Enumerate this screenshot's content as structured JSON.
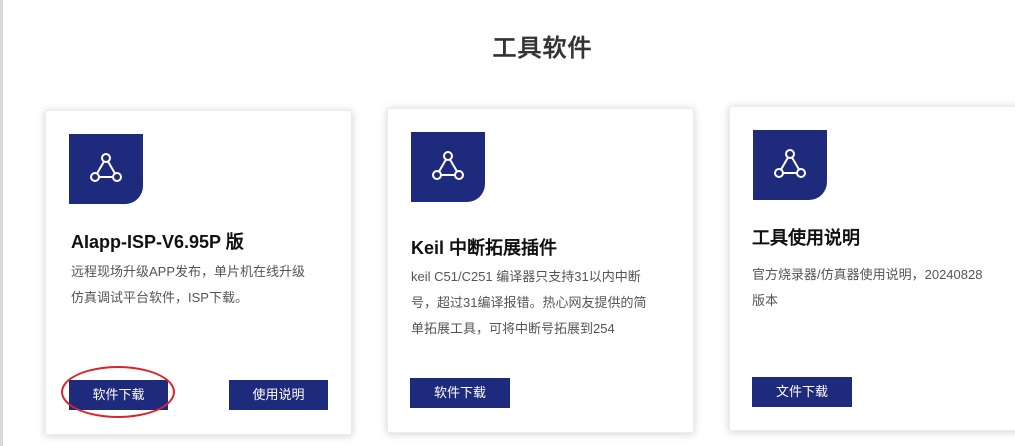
{
  "section": {
    "title": "工具软件"
  },
  "cards": [
    {
      "icon": "triangle-network-icon",
      "title": "AIapp-ISP-V6.95P 版",
      "desc_lines": [
        "远程现场升级APP发布，单片机在线升级",
        "仿真调试平台软件，ISP下载。"
      ],
      "buttons": [
        "软件下载",
        "使用说明"
      ]
    },
    {
      "icon": "triangle-network-icon",
      "title": "Keil 中断拓展插件",
      "desc_lines": [
        "keil C51/C251 编译器只支持31以内中断",
        "号，超过31编译报错。热心网友提供的简",
        "单拓展工具，可将中断号拓展到254"
      ],
      "buttons": [
        "软件下载"
      ]
    },
    {
      "icon": "triangle-network-icon",
      "title": "工具使用说明",
      "desc_lines": [
        "官方烧录器/仿真器使用说明，20240828",
        "版本"
      ],
      "buttons": [
        "文件下载"
      ]
    }
  ],
  "colors": {
    "accent": "#1e2a7c",
    "annotation": "#d9232d"
  }
}
